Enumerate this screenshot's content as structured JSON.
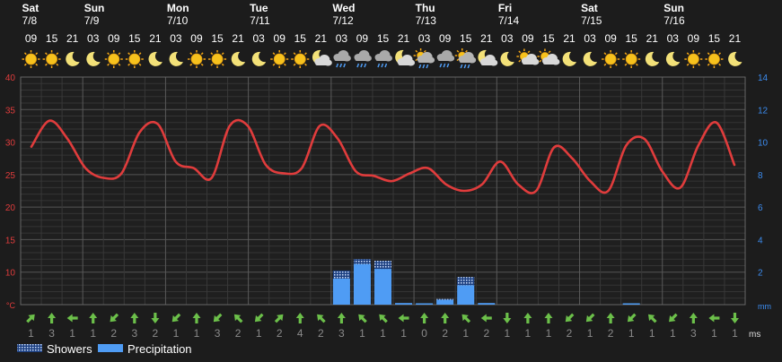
{
  "chart_data": {
    "type": "line",
    "days": [
      {
        "name": "Sat",
        "date": "7/8"
      },
      {
        "name": "Sun",
        "date": "7/9"
      },
      {
        "name": "Mon",
        "date": "7/10"
      },
      {
        "name": "Tue",
        "date": "7/11"
      },
      {
        "name": "Wed",
        "date": "7/12"
      },
      {
        "name": "Thu",
        "date": "7/13"
      },
      {
        "name": "Fri",
        "date": "7/14"
      },
      {
        "name": "Sat",
        "date": "7/15"
      },
      {
        "name": "Sun",
        "date": "7/16"
      }
    ],
    "hours": [
      "09",
      "15",
      "21",
      "03",
      "09",
      "15",
      "21",
      "03",
      "09",
      "15",
      "21",
      "03",
      "09",
      "15",
      "21",
      "03",
      "09",
      "15",
      "21",
      "03",
      "09",
      "15",
      "21",
      "03",
      "09",
      "15",
      "21",
      "03",
      "09",
      "15",
      "21",
      "03",
      "09",
      "15",
      "21"
    ],
    "icons": [
      "sun",
      "sun",
      "moon",
      "moon",
      "sun",
      "sun",
      "moon",
      "moon",
      "sun",
      "sun",
      "moon",
      "moon",
      "sun",
      "sun",
      "moon-cloud",
      "cloud-rain",
      "cloud-rain",
      "cloud-rain",
      "moon-cloud",
      "sun-cloud-rain",
      "cloud-rain",
      "sun-cloud-rain",
      "moon-cloud",
      "moon",
      "sun-cloud",
      "sun-cloud",
      "moon",
      "moon",
      "sun",
      "sun",
      "moon",
      "moon",
      "sun",
      "sun",
      "moon"
    ],
    "temperature_unit": "°C",
    "temperature": [
      29.3,
      33.3,
      30.5,
      26.0,
      24.5,
      25.2,
      31.5,
      32.8,
      27.0,
      26.0,
      24.5,
      32.5,
      32.5,
      26.5,
      25.2,
      26.0,
      32.5,
      30.5,
      25.5,
      24.8,
      24.0,
      25.2,
      26.0,
      23.5,
      22.5,
      23.5,
      27.0,
      23.5,
      22.5,
      29.2,
      27.5,
      24.0,
      22.5,
      29.5,
      30.5,
      25.5,
      23.0,
      29.5,
      33.0,
      26.5
    ],
    "temperature_axis": {
      "min": 5,
      "max": 40,
      "ticks": [
        10,
        15,
        20,
        25,
        30,
        35,
        40
      ]
    },
    "precip_axis": {
      "unit": "mm",
      "min": 0,
      "max": 14,
      "ticks": [
        2,
        4,
        6,
        8,
        10,
        12,
        14
      ]
    },
    "precipitation": [
      0,
      0,
      0,
      0,
      0,
      0,
      0,
      0,
      0,
      0,
      0,
      0,
      0,
      0,
      0,
      1.6,
      2.5,
      2.2,
      0.1,
      0.05,
      0.3,
      1.2,
      0.1,
      0,
      0,
      0,
      0,
      0,
      0,
      0.02,
      0,
      0,
      0,
      0,
      0
    ],
    "showers": [
      0,
      0,
      0,
      0,
      0,
      0,
      0,
      0,
      0,
      0,
      0,
      0,
      0,
      0,
      0,
      0.5,
      0.3,
      0.5,
      0,
      0,
      0.05,
      0.5,
      0,
      0,
      0,
      0,
      0,
      0,
      0,
      0,
      0,
      0,
      0,
      0,
      0
    ],
    "wind_dir": [
      45,
      0,
      270,
      0,
      225,
      0,
      180,
      225,
      0,
      225,
      315,
      225,
      45,
      0,
      315,
      0,
      315,
      315,
      270,
      0,
      0,
      315,
      270,
      180,
      0,
      0,
      225,
      225,
      0,
      225,
      315,
      225,
      0,
      270,
      180
    ],
    "wind_speed": [
      1,
      3,
      1,
      1,
      2,
      3,
      2,
      1,
      1,
      3,
      2,
      1,
      2,
      4,
      2,
      3,
      1,
      1,
      1,
      0,
      2,
      1,
      2,
      1,
      1,
      1,
      2,
      1,
      2,
      1,
      1,
      1,
      3,
      1,
      1
    ],
    "wind_unit": "ms",
    "legend": [
      {
        "label": "Showers",
        "color": "#3b6fd6"
      },
      {
        "label": "Precipitation",
        "color": "#4f9cf4"
      }
    ],
    "colors": {
      "temperature": "#e03c3c",
      "precipitation": "#4f9cf4",
      "wind": "#6cc04a"
    }
  }
}
